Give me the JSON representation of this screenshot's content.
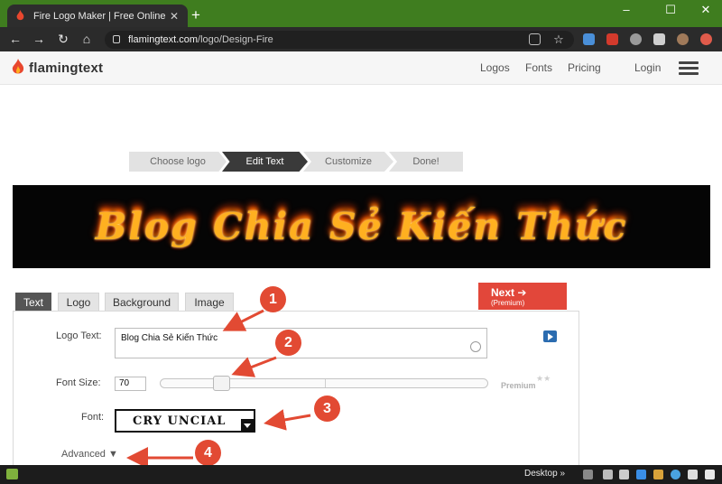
{
  "browser": {
    "tab_title": "Fire Logo Maker | Free Online De",
    "new_tab": "+",
    "url_host": "flamingtext.com",
    "url_path": "/logo/Design-Fire",
    "window_controls": [
      "–",
      "☐",
      "✕"
    ],
    "nav_icons": [
      "back-icon",
      "forward-icon",
      "reload-icon",
      "home-icon"
    ]
  },
  "site": {
    "logo_text": "flamingtext",
    "nav": {
      "logos": "Logos",
      "fonts": "Fonts",
      "pricing": "Pricing",
      "login": "Login"
    }
  },
  "steps": [
    {
      "label": "Choose logo",
      "active": false
    },
    {
      "label": "Edit Text",
      "active": true
    },
    {
      "label": "Customize",
      "active": false
    },
    {
      "label": "Done!",
      "active": false
    }
  ],
  "banner": {
    "text": "Blog Chia Sẻ Kiến Thức"
  },
  "editor": {
    "tabs": [
      "Text",
      "Logo",
      "Background",
      "Image"
    ],
    "active_tab": "Text",
    "next_label": "Next ➔",
    "next_sub": "(Premium)",
    "logo_text_label": "Logo Text:",
    "logo_text_value": "Blog Chia Sẻ Kiến Thức",
    "font_size_label": "Font Size:",
    "font_size_value": "70",
    "font_size_slider_fraction": 0.17,
    "premium_label": "Premium",
    "font_label": "Font:",
    "font_value": "CRY UNCIAL",
    "advanced_label": "Advanced ▼"
  },
  "annotations": [
    "1",
    "2",
    "3",
    "4"
  ],
  "taskbar": {
    "desktop_label": "Desktop",
    "chevron": "»"
  },
  "colors": {
    "browser_accent": "#3f7d1f",
    "next_button": "#e2473a",
    "annotation": "#e24a33",
    "fire": "#ffb020"
  }
}
